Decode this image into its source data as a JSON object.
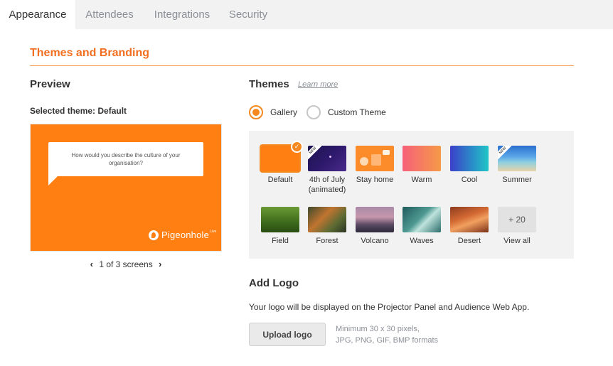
{
  "tabs": [
    {
      "label": "Appearance",
      "active": true
    },
    {
      "label": "Attendees",
      "active": false
    },
    {
      "label": "Integrations",
      "active": false
    },
    {
      "label": "Security",
      "active": false
    }
  ],
  "section": {
    "title": "Themes and Branding"
  },
  "preview": {
    "heading": "Preview",
    "selected_theme": "Selected theme: Default",
    "question": "How would you describe the culture of your organisation?",
    "brand_name": "Pigeonhole",
    "brand_suffix": "Live",
    "pager": "1 of 3 screens",
    "background_color": "#ff7f12"
  },
  "themes": {
    "heading": "Themes",
    "learn_more": "Learn more",
    "mode_options": [
      {
        "label": "Gallery",
        "selected": true
      },
      {
        "label": "Custom Theme",
        "selected": false
      }
    ],
    "new_badge": "NEW",
    "items": [
      {
        "label": "Default",
        "selected": true,
        "is_new": false
      },
      {
        "label": "4th of July",
        "label2": "(animated)",
        "is_new": true
      },
      {
        "label": "Stay home",
        "is_new": false
      },
      {
        "label": "Warm",
        "is_new": false
      },
      {
        "label": "Cool",
        "is_new": false
      },
      {
        "label": "Summer",
        "is_new": true
      },
      {
        "label": "Field",
        "is_new": false
      },
      {
        "label": "Forest",
        "is_new": false
      },
      {
        "label": "Volcano",
        "is_new": false
      },
      {
        "label": "Waves",
        "is_new": false
      },
      {
        "label": "Desert",
        "is_new": false
      }
    ],
    "more_count": "+ 20",
    "view_all": "View all",
    "accent_color": "#f5891f"
  },
  "logo": {
    "heading": "Add Logo",
    "description": "Your logo will be displayed on the Projector Panel and Audience Web App.",
    "upload_label": "Upload logo",
    "hint_line1": "Minimum 30 x 30 pixels,",
    "hint_line2": "JPG, PNG, GIF, BMP formats"
  }
}
